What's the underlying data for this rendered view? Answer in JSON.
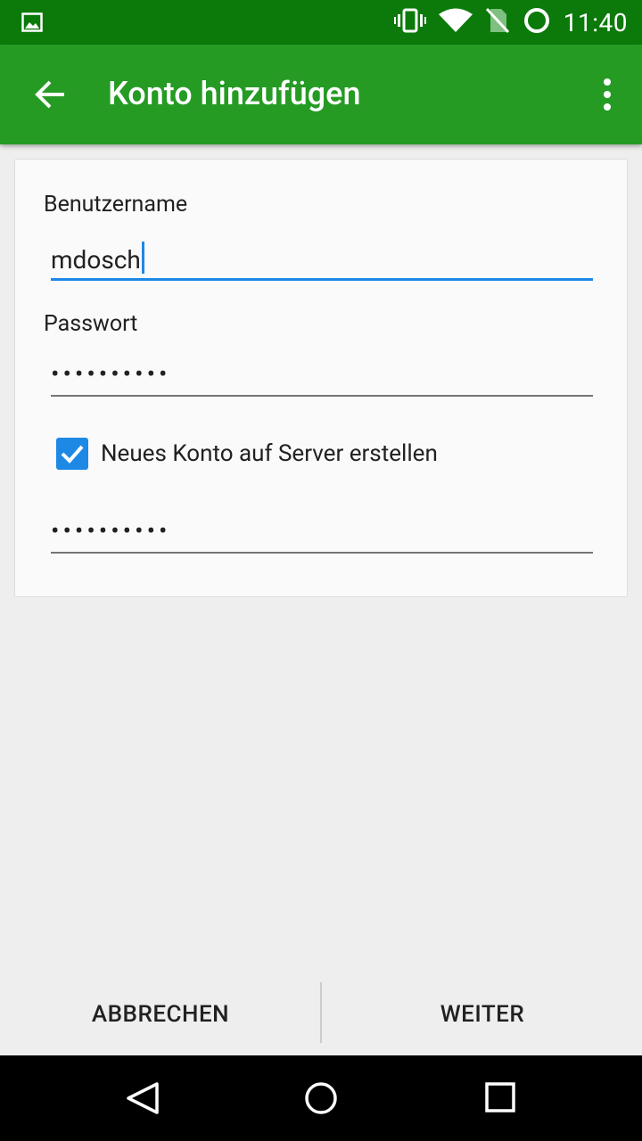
{
  "status_bar": {
    "time": "11:40",
    "icons": [
      "image-icon",
      "vibrate-icon",
      "wifi-icon",
      "no-sim-icon",
      "battery-ring-icon"
    ]
  },
  "app_bar": {
    "title": "Konto hinzufügen",
    "back_icon": "arrow-back-icon",
    "menu_icon": "more-vert-icon",
    "color": "#259b24"
  },
  "form": {
    "username_label": "Benutzername",
    "username_value": "mdosch",
    "password_label": "Passwort",
    "password_value": "••••••••••",
    "checkbox_label": "Neues Konto auf Server erstellen",
    "checkbox_checked": true,
    "confirm_password_value": "••••••••••"
  },
  "actions": {
    "cancel": "ABBRECHEN",
    "next": "WEITER"
  },
  "nav_bar": {
    "icons": [
      "back-triangle-icon",
      "home-circle-icon",
      "recents-square-icon"
    ]
  },
  "colors": {
    "status_bar": "#0b7a0b",
    "accent": "#1e88e5"
  }
}
